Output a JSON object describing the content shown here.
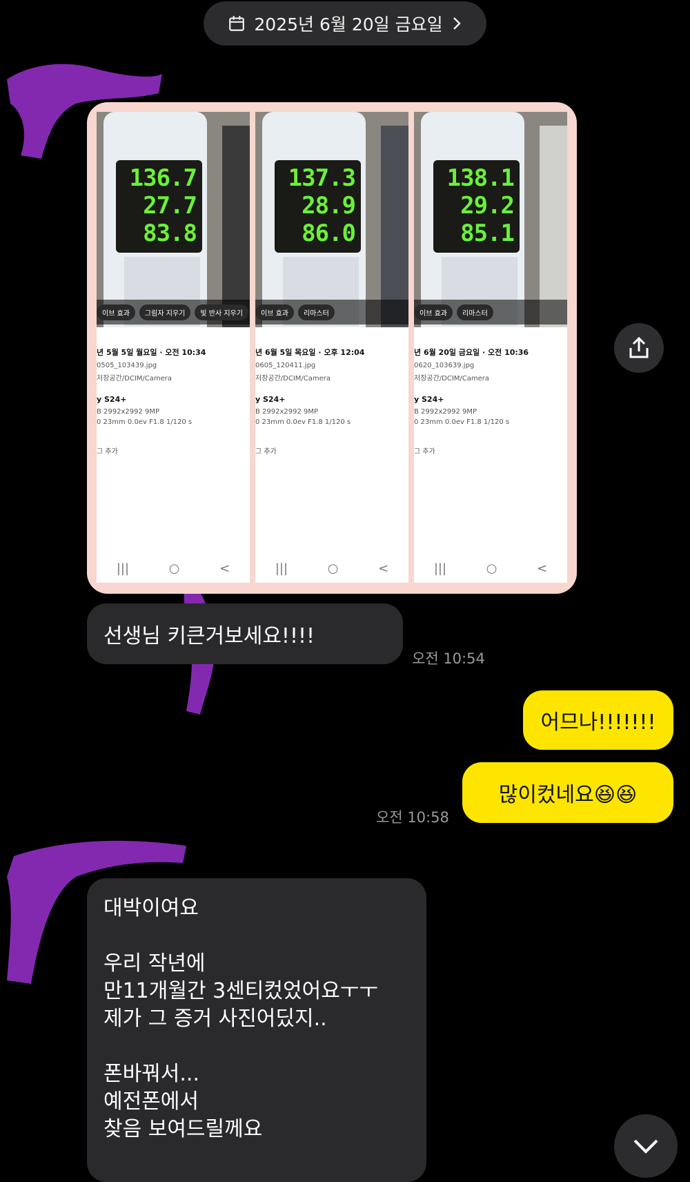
{
  "date_header": {
    "label": "2025년 6월 20일 금요일",
    "icon": "calendar-icon",
    "chevron": "chevron-right-icon"
  },
  "photos": [
    {
      "readings": [
        "136.7",
        "27.7",
        "83.8"
      ],
      "edit_chips": [
        "이브 효과",
        "그림자 지우기",
        "빛 반사 지우기"
      ],
      "date": "년 5월 5일 월요일 · 오전 10:34",
      "filename": "0505_103439.jpg",
      "path": "저장공간/DCIM/Camera",
      "model": "y S24+",
      "resolution": "B    2992x2992    9MP",
      "exif": "0    23mm    0.0ev    F1.8    1/120 s",
      "tag": "그 추가"
    },
    {
      "readings": [
        "137.3",
        "28.9",
        "86.0"
      ],
      "edit_chips": [
        "이브 효과",
        "리마스터"
      ],
      "date": "년 6월 5일 목요일 · 오후 12:04",
      "filename": "0605_120411.jpg",
      "path": "저장공간/DCIM/Camera",
      "model": "y S24+",
      "resolution": "B    2992x2992    9MP",
      "exif": "0    23mm    0.0ev    F1.8    1/120 s",
      "tag": "그 추가"
    },
    {
      "readings": [
        "138.1",
        "29.2",
        "85.1"
      ],
      "edit_chips": [
        "이브 효과",
        "리마스터"
      ],
      "date": "년 6월 20일 금요일 · 오전 10:36",
      "filename": "0620_103639.jpg",
      "path": "저장공간/DCIM/Camera",
      "model": "y S24+",
      "resolution": "B    2992x2992    9MP",
      "exif": "0    23mm    0.0ev    F1.8    1/120 s",
      "tag": "그 추가"
    }
  ],
  "navbar_glyphs": {
    "recent": "|||",
    "home": "○",
    "back": "<"
  },
  "messages": {
    "incoming_1": {
      "text": "선생님 키큰거보세요!!!!",
      "time": "오전 10:54"
    },
    "outgoing_1": {
      "text": "어므나!!!!!!!"
    },
    "outgoing_2": {
      "text": "많이컸네요😆😆",
      "time": "오전 10:58"
    },
    "incoming_2": {
      "text": "대박이여요\n\n우리 작년에\n만11개월간 3센티컸었어요ㅜㅜ\n제가 그 증거 사진어딨지..\n\n폰바꿔서...\n예전폰에서\n찾음 보여드릴께요"
    }
  },
  "icons": {
    "share": "share-icon",
    "lens": "text-scan-icon",
    "scroll_down": "chevron-down-icon"
  },
  "colors": {
    "background": "#000000",
    "incoming_bubble": "#2a2a2c",
    "outgoing_bubble": "#fde500",
    "scribble": "#8a2bb8"
  }
}
